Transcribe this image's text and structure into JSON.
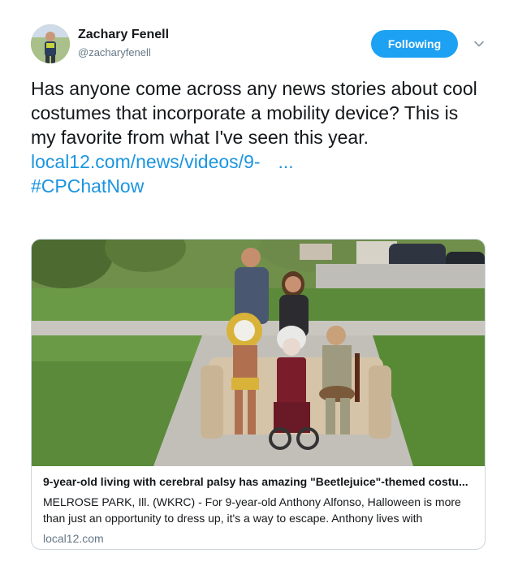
{
  "user": {
    "name": "Zachary Fenell",
    "handle": "@zacharyfenell"
  },
  "follow_button": {
    "label": "Following"
  },
  "tweet": {
    "text": "Has anyone come across any news stories about cool costumes that incorporate a mobility device? This is my favorite from what I've seen this year.",
    "link_text": "local12.com/news/videos/9-",
    "link_ellipsis": "...",
    "hashtag": "#CPChatNow"
  },
  "card": {
    "title": "9-year-old living with cerebral palsy has amazing \"Beetlejuice\"-themed costu...",
    "description": "MELROSE PARK, Ill. (WKRC) - For 9-year-old Anthony Alfonso, Halloween is more than just an opportunity to dress up, it's a way to escape. Anthony lives with",
    "domain": "local12.com"
  },
  "colors": {
    "accent": "#1da1f2",
    "link": "#1b95e0",
    "secondary_text": "#657786",
    "border": "#ccd6dd"
  },
  "icons": {
    "caret": "chevron-down-icon"
  }
}
